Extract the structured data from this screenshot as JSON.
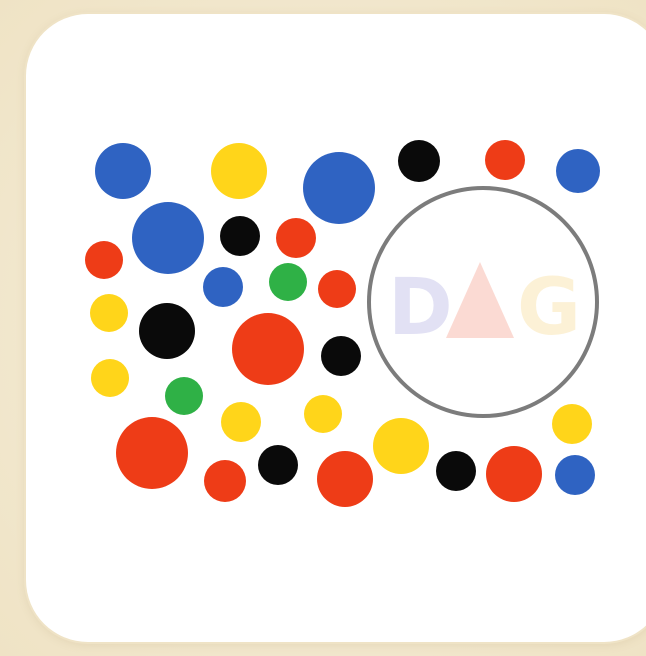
{
  "game": {
    "mode": "spot-the-dots",
    "colors": {
      "blue": "#2f63c2",
      "yellow": "#ffd51a",
      "black": "#0a0a0a",
      "red": "#ee3c17",
      "green": "#2fb146",
      "ring": "#7c7c7c",
      "card": "#ffffff",
      "background": "#f3ead2"
    },
    "watermark": {
      "text": "DAG"
    }
  }
}
